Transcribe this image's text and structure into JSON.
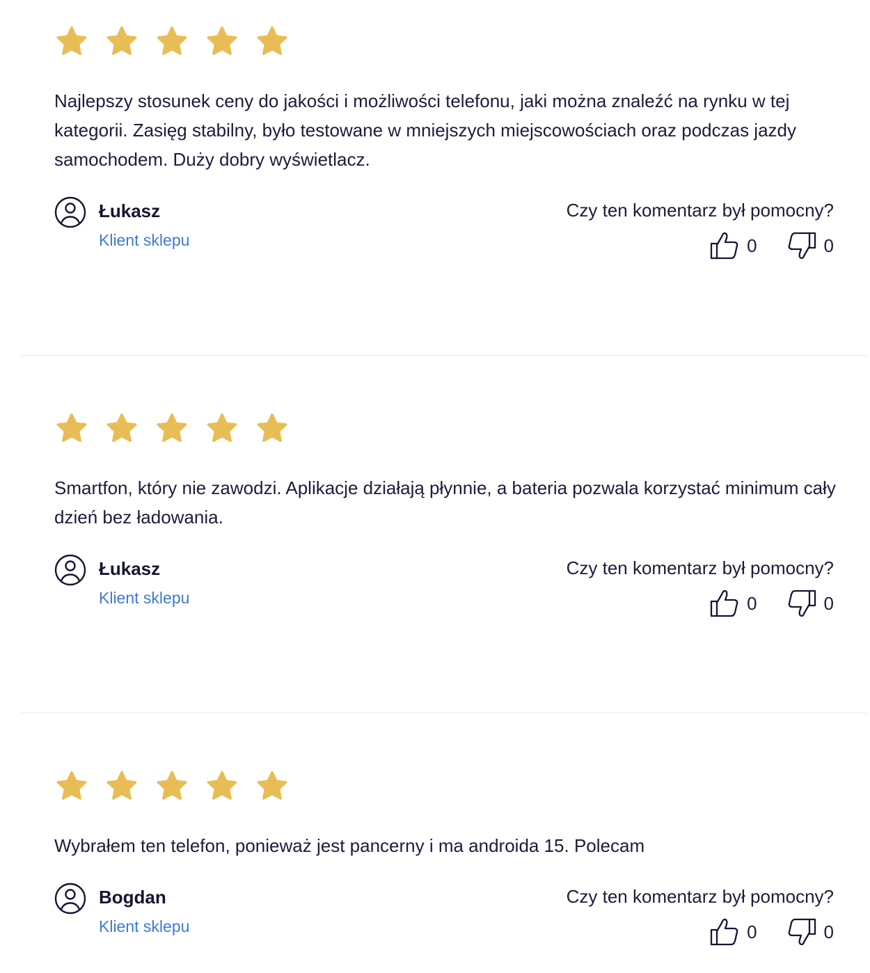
{
  "colors": {
    "star": "#e9bd55",
    "text": "#1b1d3a",
    "role": "#3d7ad6",
    "divider": "#e8e8ee"
  },
  "helpful_question": "Czy ten komentarz był pomocny?",
  "reviews": [
    {
      "rating": 5,
      "text": "Najlepszy stosunek ceny do jakości i możliwości telefonu, jaki można znaleźć na rynku w tej kategorii. Zasięg stabilny, było testowane w mniejszych miejscowościach oraz podczas jazdy samochodem. Duży dobry wyświetlacz.",
      "author": "Łukasz",
      "role": "Klient sklepu",
      "likes": "0",
      "dislikes": "0"
    },
    {
      "rating": 5,
      "text": "Smartfon, który nie zawodzi. Aplikacje działają płynnie, a bateria pozwala korzystać minimum cały dzień bez ładowania.",
      "author": "Łukasz",
      "role": "Klient sklepu",
      "likes": "0",
      "dislikes": "0"
    },
    {
      "rating": 5,
      "text": "Wybrałem ten telefon, ponieważ jest pancerny i ma androida 15. Polecam",
      "author": "Bogdan",
      "role": "Klient sklepu",
      "likes": "0",
      "dislikes": "0"
    }
  ],
  "icons": {
    "star": "star-icon",
    "avatar": "user-circle-icon",
    "like": "thumbs-up-icon",
    "dislike": "thumbs-down-icon"
  }
}
